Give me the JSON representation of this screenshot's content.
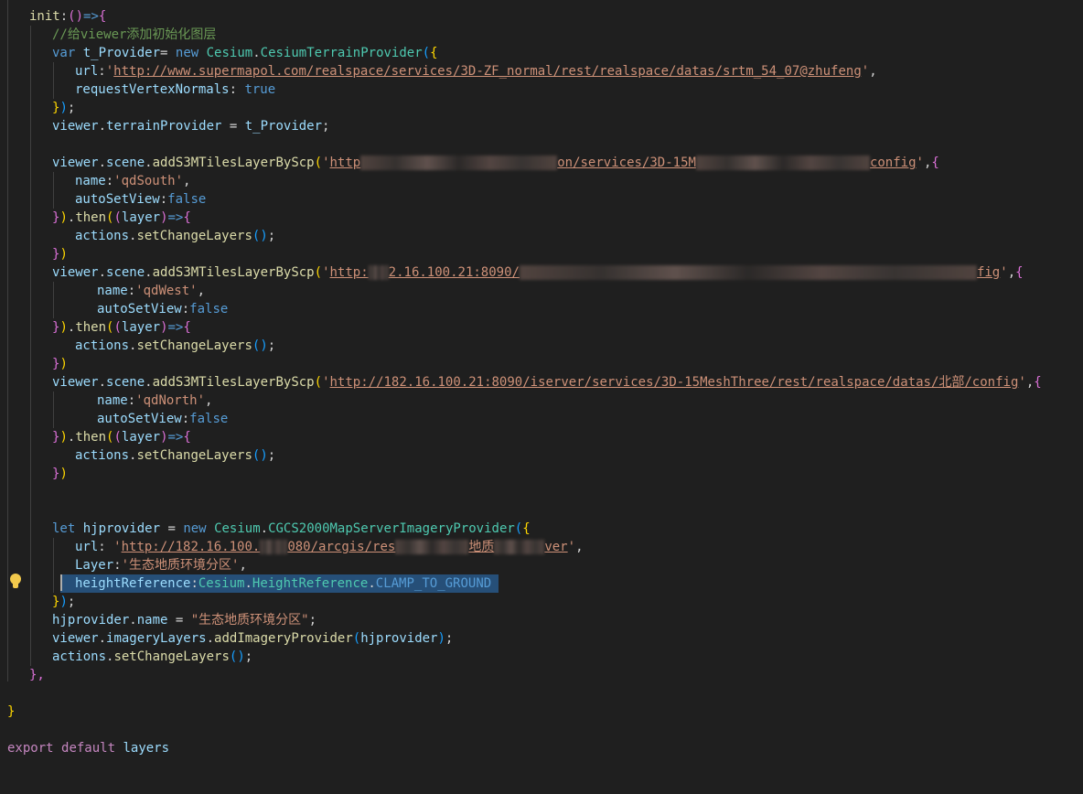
{
  "editor": {
    "language": "javascript",
    "background": "#1f1f1f",
    "selection_color": "#264f78",
    "lines": {
      "l1": {
        "a": "init",
        "b": ":",
        "c": "()",
        "d": "=>",
        "e": "{"
      },
      "l2": {
        "a": "//给viewer添加初始化图层"
      },
      "l3": {
        "a": "var",
        "b": "t_Provider",
        "c": "= ",
        "d": "new",
        "e": "Cesium",
        "f": ".",
        "g": "CesiumTerrainProvider",
        "h": "(",
        "i": "{"
      },
      "l4": {
        "a": "url",
        "b": ":",
        "c": "'",
        "d": "http://www.supermapol.com/realspace/services/3D-ZF_normal/rest/realspace/datas/srtm_54_07@zhufeng",
        "e": "'",
        ",": ","
      },
      "l5": {
        "a": "requestVertexNormals",
        "b": ": ",
        "c": "true"
      },
      "l6": {
        "a": "}",
        "b": ")",
        "c": ";"
      },
      "l7": {
        "a": "viewer",
        "b": ".",
        "c": "terrainProvider",
        "d": " = ",
        "e": "t_Provider",
        "f": ";"
      },
      "l8": {
        "a": "viewer",
        "b": ".",
        "c": "scene",
        "d": ".",
        "e": "addS3MTilesLayerByScp",
        "f": "(",
        "g": "'",
        "h": "http",
        "i": "on/services/3D-15M",
        "j": "config",
        "k": "'",
        ",": ",",
        "l": "{"
      },
      "l9": {
        "a": "name",
        "b": ":",
        "c": "'qdSouth'",
        "d": ","
      },
      "l10": {
        "a": "autoSetView",
        "b": ":",
        "c": "false"
      },
      "l11": {
        "a": "})",
        "b": ".",
        "c": "then",
        "d": "(",
        "e": "(",
        "f": "layer",
        "g": ")",
        "h": "=>",
        "i": "{"
      },
      "l12": {
        "a": "actions",
        "b": ".",
        "c": "setChangeLayers",
        "d": "()",
        "e": ";"
      },
      "l13": {
        "a": "})"
      },
      "l14": {
        "a": "viewer",
        "b": ".",
        "c": "scene",
        "d": ".",
        "e": "addS3MTilesLayerByScp",
        "f": "(",
        "g": "'",
        "h": "http:",
        "i": "2.16.100.21:8090/",
        "j": "fig",
        "k": "'",
        ",": ",",
        "l": "{"
      },
      "l15": {
        "a": "name",
        "b": ":",
        "c": "'qdWest'",
        "d": ","
      },
      "l16": {
        "a": "autoSetView",
        "b": ":",
        "c": "false"
      },
      "l17": {
        "a": "})",
        "b": ".",
        "c": "then",
        "d": "(",
        "e": "(",
        "f": "layer",
        "g": ")",
        "h": "=>",
        "i": "{"
      },
      "l18": {
        "a": "actions",
        "b": ".",
        "c": "setChangeLayers",
        "d": "()",
        "e": ";"
      },
      "l19": {
        "a": "})"
      },
      "l20": {
        "a": "viewer",
        "b": ".",
        "c": "scene",
        "d": ".",
        "e": "addS3MTilesLayerByScp",
        "f": "(",
        "g": "'",
        "h": "http://182.16.100.21:8090/iserver/services/3D-15MeshThree/rest/realspace/datas/北部/config",
        "k": "'",
        ",": ",",
        "l": "{"
      },
      "l21": {
        "a": "name",
        "b": ":",
        "c": "'qdNorth'",
        "d": ","
      },
      "l22": {
        "a": "autoSetView",
        "b": ":",
        "c": "false"
      },
      "l23": {
        "a": "})",
        "b": ".",
        "c": "then",
        "d": "(",
        "e": "(",
        "f": "layer",
        "g": ")",
        "h": "=>",
        "i": "{"
      },
      "l24": {
        "a": "actions",
        "b": ".",
        "c": "setChangeLayers",
        "d": "()",
        "e": ";"
      },
      "l25": {
        "a": "})"
      },
      "l26": {
        "a": "let",
        "b": "hjprovider",
        "c": " = ",
        "d": "new",
        "e": "Cesium",
        "f": ".",
        "g": "CGCS2000MapServerImageryProvider",
        "h": "(",
        "i": "{"
      },
      "l27": {
        "a": "url",
        "b": ": ",
        "c": "'",
        "d": "http://182.16.100.",
        "e": "080/arcgis/res",
        "f": "地质",
        "g": "ver",
        "h": "'",
        ",": ","
      },
      "l28": {
        "a": "Layer",
        "b": ":",
        "c": "'生态地质环境分区'",
        "d": ","
      },
      "l29": {
        "a": "heightReference",
        "b": ":",
        "c": "Cesium",
        "d": ".",
        "e": "HeightReference",
        "f": ".",
        "g": "CLAMP_TO_GROUND"
      },
      "l30": {
        "a": "}",
        "b": ")",
        "c": ";"
      },
      "l31": {
        "a": "hjprovider",
        "b": ".",
        "c": "name",
        "d": " = ",
        "e": "\"生态地质环境分区\"",
        "f": ";"
      },
      "l32": {
        "a": "viewer",
        "b": ".",
        "c": "imageryLayers",
        "d": ".",
        "e": "addImageryProvider",
        "f": "(",
        "g": "hjprovider",
        "h": ")",
        "i": ";"
      },
      "l33": {
        "a": "actions",
        "b": ".",
        "c": "setChangeLayers",
        "d": "()",
        "e": ";"
      },
      "l34": {
        "a": "},"
      },
      "l35": {
        "a": "}"
      },
      "l36": {
        "a": "export",
        "b": "default",
        "c": "layers"
      }
    }
  }
}
